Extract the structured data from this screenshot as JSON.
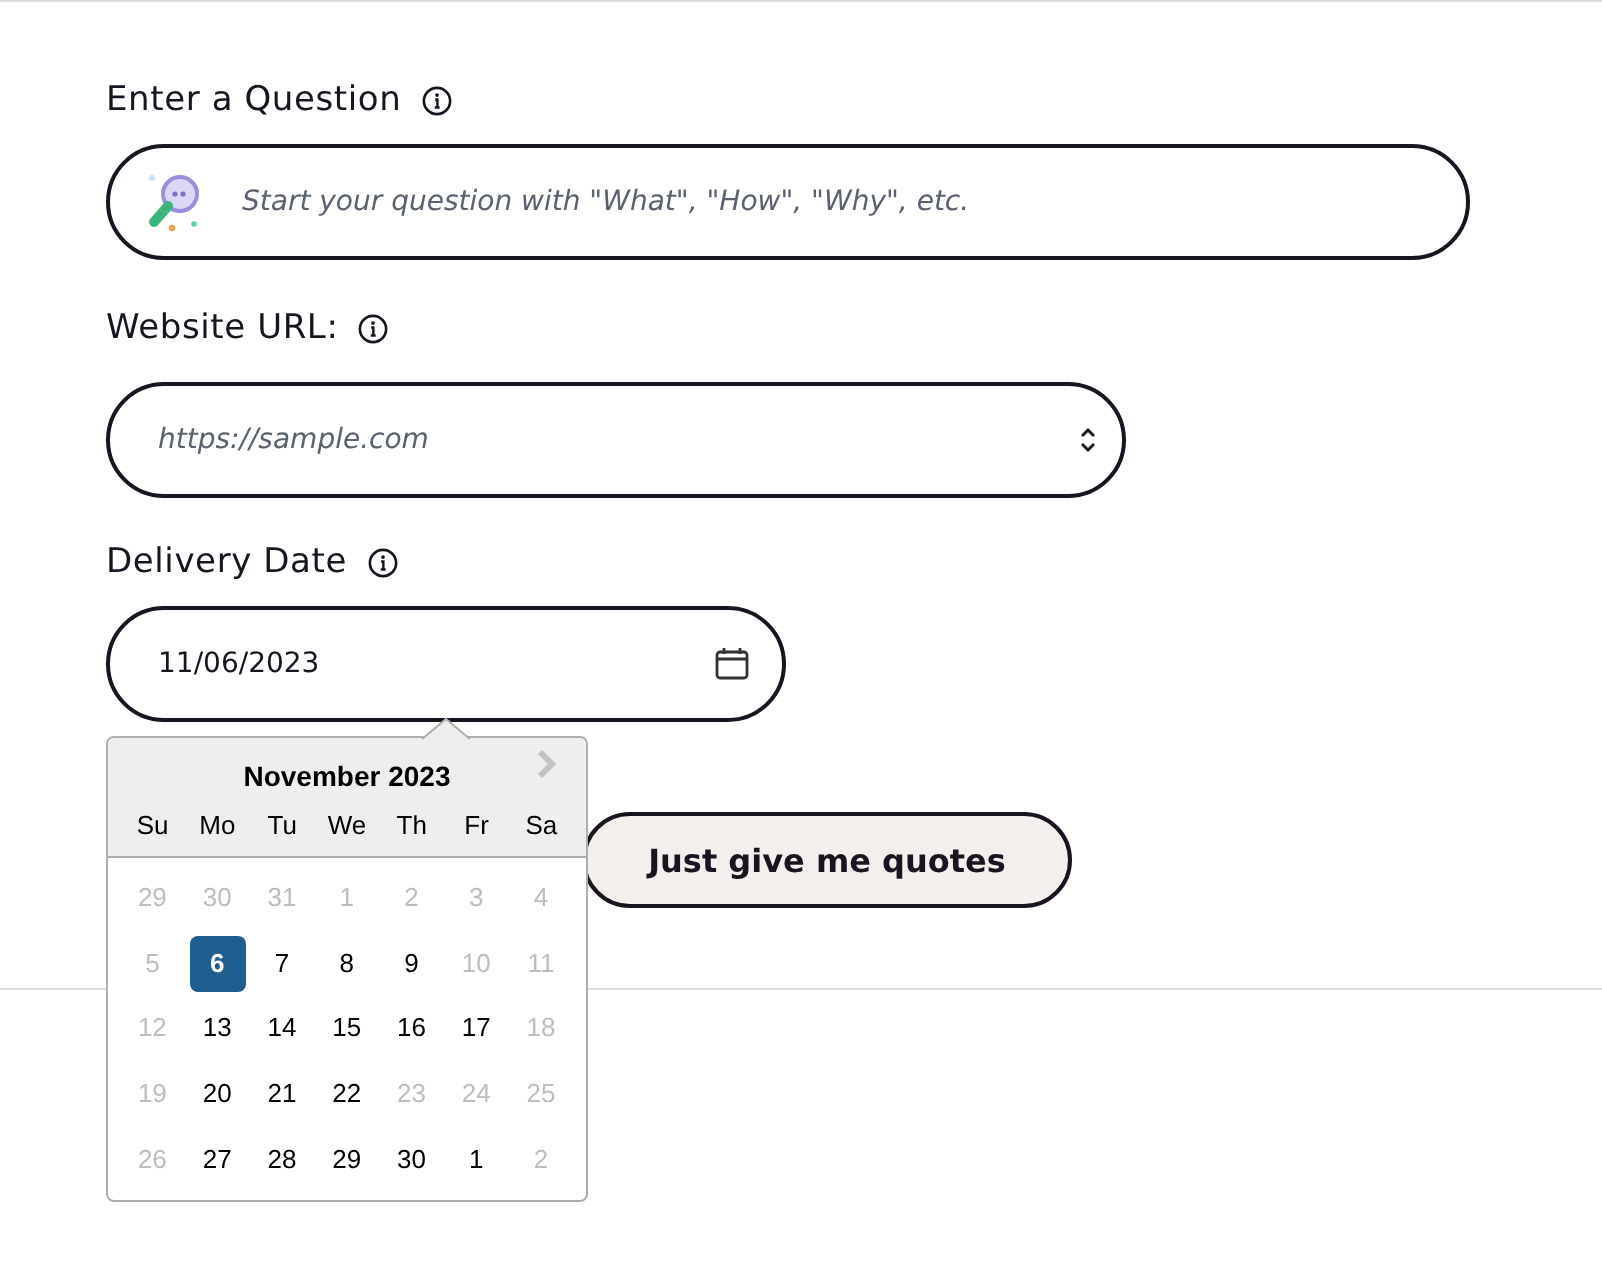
{
  "question": {
    "label": "Enter a Question",
    "placeholder": "Start your question with \"What\", \"How\", \"Why\", etc."
  },
  "website": {
    "label": "Website URL:",
    "placeholder": "https://sample.com"
  },
  "delivery": {
    "label": "Delivery Date",
    "value": "11/06/2023"
  },
  "calendar": {
    "month": "November 2023",
    "weekdays": [
      "Su",
      "Mo",
      "Tu",
      "We",
      "Th",
      "Fr",
      "Sa"
    ],
    "weeks": [
      [
        {
          "day": "29",
          "disabled": true,
          "selected": false
        },
        {
          "day": "30",
          "disabled": true,
          "selected": false
        },
        {
          "day": "31",
          "disabled": true,
          "selected": false
        },
        {
          "day": "1",
          "disabled": true,
          "selected": false
        },
        {
          "day": "2",
          "disabled": true,
          "selected": false
        },
        {
          "day": "3",
          "disabled": true,
          "selected": false
        },
        {
          "day": "4",
          "disabled": true,
          "selected": false
        }
      ],
      [
        {
          "day": "5",
          "disabled": true,
          "selected": false
        },
        {
          "day": "6",
          "disabled": false,
          "selected": true
        },
        {
          "day": "7",
          "disabled": false,
          "selected": false
        },
        {
          "day": "8",
          "disabled": false,
          "selected": false
        },
        {
          "day": "9",
          "disabled": false,
          "selected": false
        },
        {
          "day": "10",
          "disabled": true,
          "selected": false
        },
        {
          "day": "11",
          "disabled": true,
          "selected": false
        }
      ],
      [
        {
          "day": "12",
          "disabled": true,
          "selected": false
        },
        {
          "day": "13",
          "disabled": false,
          "selected": false
        },
        {
          "day": "14",
          "disabled": false,
          "selected": false
        },
        {
          "day": "15",
          "disabled": false,
          "selected": false
        },
        {
          "day": "16",
          "disabled": false,
          "selected": false
        },
        {
          "day": "17",
          "disabled": false,
          "selected": false
        },
        {
          "day": "18",
          "disabled": true,
          "selected": false
        }
      ],
      [
        {
          "day": "19",
          "disabled": true,
          "selected": false
        },
        {
          "day": "20",
          "disabled": false,
          "selected": false
        },
        {
          "day": "21",
          "disabled": false,
          "selected": false
        },
        {
          "day": "22",
          "disabled": false,
          "selected": false
        },
        {
          "day": "23",
          "disabled": true,
          "selected": false
        },
        {
          "day": "24",
          "disabled": true,
          "selected": false
        },
        {
          "day": "25",
          "disabled": true,
          "selected": false
        }
      ],
      [
        {
          "day": "26",
          "disabled": true,
          "selected": false
        },
        {
          "day": "27",
          "disabled": false,
          "selected": false
        },
        {
          "day": "28",
          "disabled": false,
          "selected": false
        },
        {
          "day": "29",
          "disabled": false,
          "selected": false
        },
        {
          "day": "30",
          "disabled": false,
          "selected": false
        },
        {
          "day": "1",
          "disabled": false,
          "selected": false
        },
        {
          "day": "2",
          "disabled": true,
          "selected": false
        }
      ]
    ]
  },
  "quotes_button": {
    "label": "Just give me quotes"
  }
}
